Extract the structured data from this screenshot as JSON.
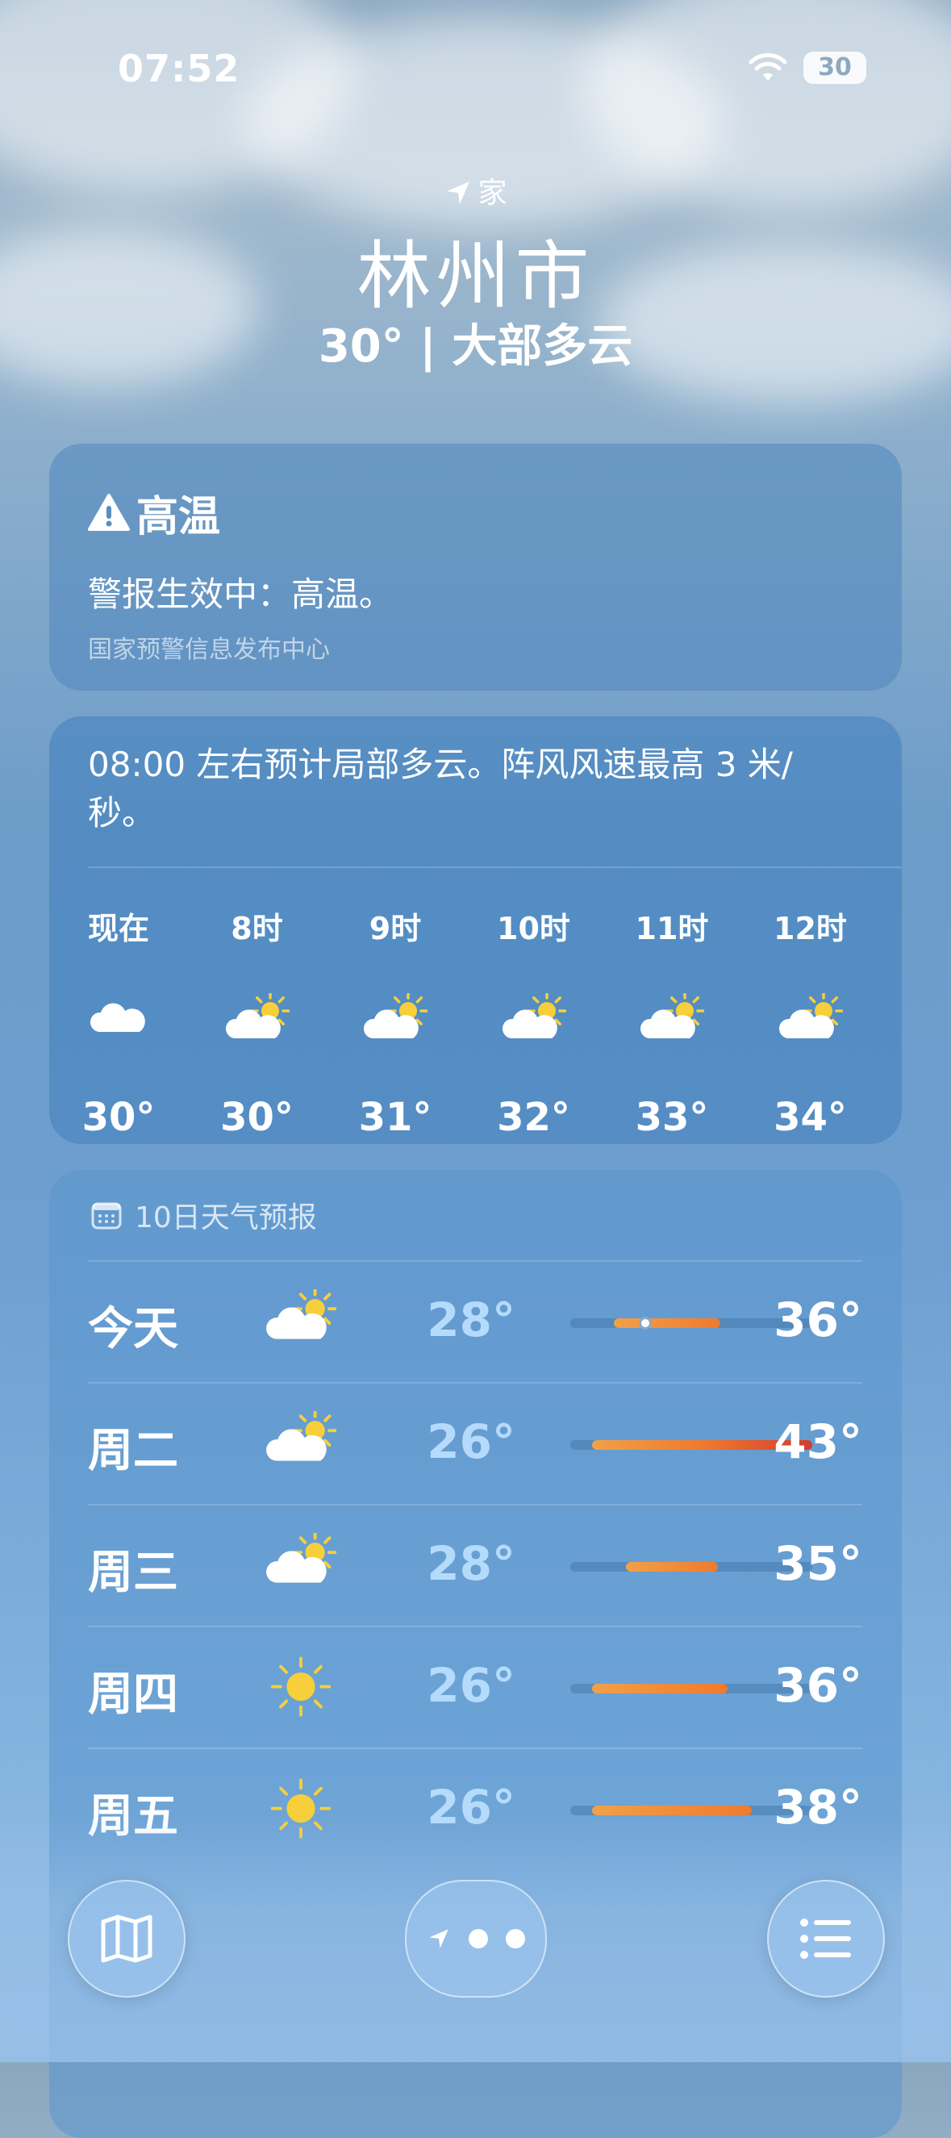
{
  "status_bar": {
    "time": "07:52",
    "battery": "30"
  },
  "header": {
    "location_label": "家",
    "city": "林州市",
    "current": "30° | 大部多云"
  },
  "alert": {
    "title": "高温",
    "text": "警报生效中：高温。",
    "source": "国家预警信息发布中心"
  },
  "hourly": {
    "summary": "08:00 左右预计局部多云。阵风风速最高 3 米/秒。",
    "hours": [
      {
        "label": "现在",
        "icon": "cloud-icon",
        "temp": "30°"
      },
      {
        "label": "8时",
        "icon": "partly-sunny-icon",
        "temp": "30°"
      },
      {
        "label": "9时",
        "icon": "partly-sunny-icon",
        "temp": "31°"
      },
      {
        "label": "10时",
        "icon": "partly-sunny-icon",
        "temp": "32°"
      },
      {
        "label": "11时",
        "icon": "partly-sunny-icon",
        "temp": "33°"
      },
      {
        "label": "12时",
        "icon": "partly-sunny-icon",
        "temp": "34°"
      }
    ]
  },
  "forecast": {
    "title": "10日天气预报",
    "days": [
      {
        "day": "今天",
        "icon": "partly-sunny-icon",
        "low": "28°",
        "high": "36°",
        "range": [
          0.18,
          0.62
        ],
        "current_marker": 0.31
      },
      {
        "day": "周二",
        "icon": "partly-sunny-icon",
        "low": "26°",
        "high": "43°",
        "range": [
          0.09,
          1.0
        ]
      },
      {
        "day": "周三",
        "icon": "partly-sunny-icon",
        "low": "28°",
        "high": "35°",
        "range": [
          0.23,
          0.61
        ]
      },
      {
        "day": "周四",
        "icon": "sun-icon",
        "low": "26°",
        "high": "36°",
        "range": [
          0.09,
          0.65
        ]
      },
      {
        "day": "周五",
        "icon": "sun-icon",
        "low": "26°",
        "high": "38°",
        "range": [
          0.09,
          0.75
        ]
      }
    ]
  },
  "colors": {
    "bar_start": "#f1a04a",
    "bar_end": "#ef7a2e",
    "bar_hot": "#d43b2f"
  }
}
